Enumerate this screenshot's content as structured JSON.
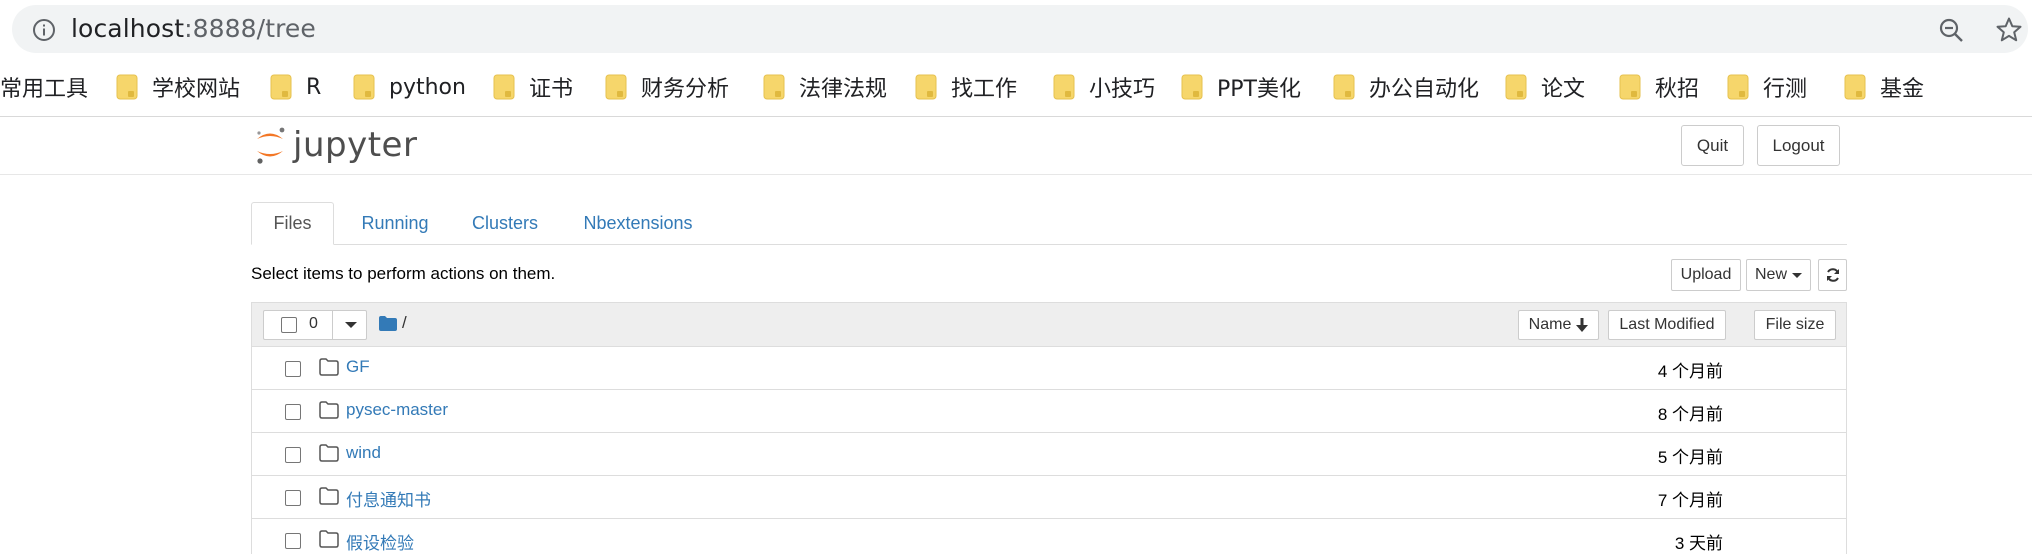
{
  "browser": {
    "url_host": "localhost",
    "url_path": ":8888/tree",
    "bookmarks": [
      "常用工具",
      "学校网站",
      "R",
      "python",
      "证书",
      "财务分析",
      "法律法规",
      "找工作",
      "小技巧",
      "PPT美化",
      "办公自动化",
      "论文",
      "秋招",
      "行测",
      "基金"
    ]
  },
  "header": {
    "logo_text": "jupyter",
    "quit_label": "Quit",
    "logout_label": "Logout"
  },
  "tabs": [
    "Files",
    "Running",
    "Clusters",
    "Nbextensions"
  ],
  "toolbar": {
    "instructions": "Select items to perform actions on them.",
    "upload_label": "Upload",
    "new_label": "New"
  },
  "list_header": {
    "selected_count": "0",
    "breadcrumb": "/",
    "sort_name": "Name",
    "sort_modified": "Last Modified",
    "sort_size": "File size"
  },
  "files": [
    {
      "name": "GF",
      "modified": "4 个月前"
    },
    {
      "name": "pysec-master",
      "modified": "8 个月前"
    },
    {
      "name": "wind",
      "modified": "5 个月前"
    },
    {
      "name": "付息通知书",
      "modified": "7 个月前"
    },
    {
      "name": "假设检验",
      "modified": "3 天前"
    }
  ],
  "colors": {
    "link": "#337ab7",
    "folder_bookmark": "#f6d66b",
    "logo_orange": "#f37726"
  }
}
